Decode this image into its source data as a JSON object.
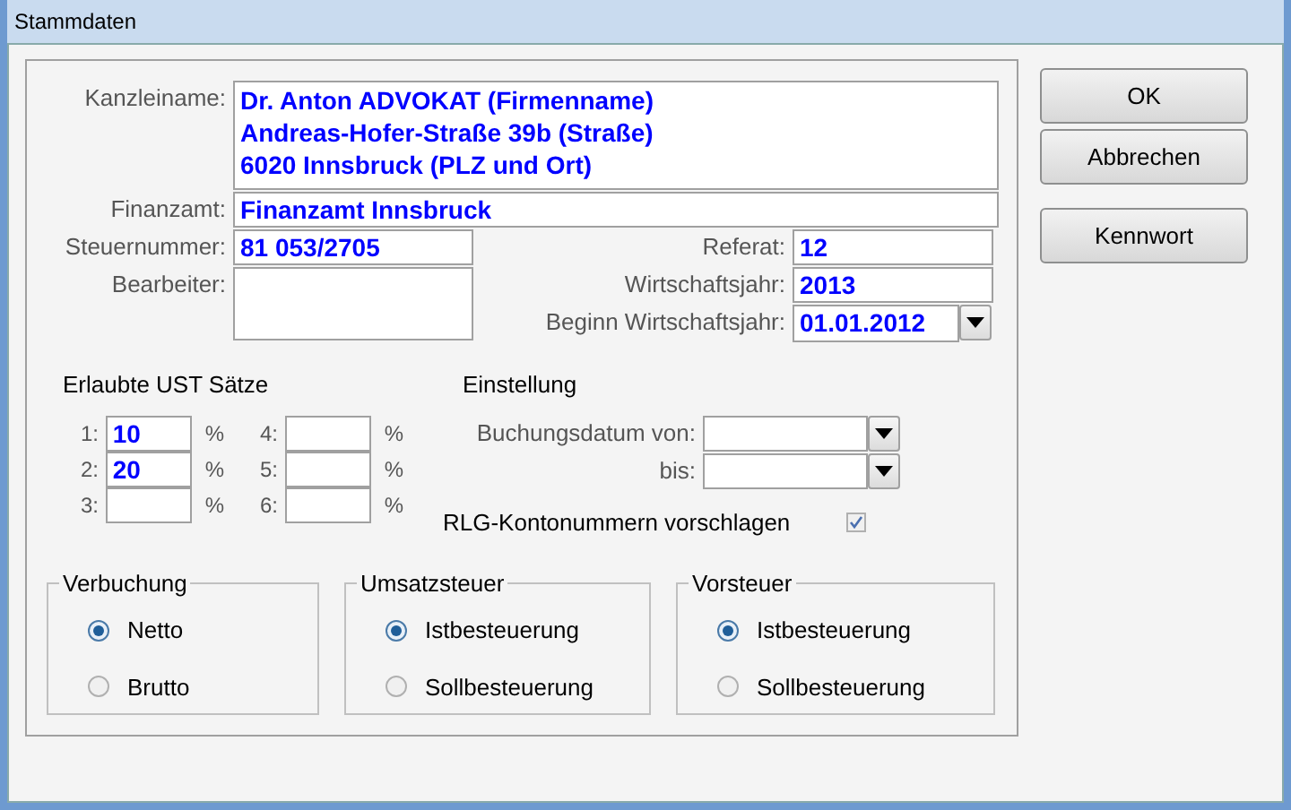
{
  "window": {
    "title": "Stammdaten"
  },
  "fields": [
    {
      "label": "Kanzleiname:",
      "kind": "multiline",
      "lines": [
        "Dr. Anton ADVOKAT (Firmenname)",
        "Andreas-Hofer-Straße 39b (Straße)",
        "6020 Innsbruck (PLZ und Ort)"
      ]
    },
    {
      "label": "Finanzamt:",
      "kind": "wide",
      "value": "Finanzamt Innsbruck"
    }
  ],
  "left_fields": [
    {
      "label": "Steuernummer:",
      "kind": "single",
      "value": "81 053/2705"
    },
    {
      "label": "Bearbeiter:",
      "kind": "multiline"
    }
  ],
  "right_fields": [
    {
      "label": "Referat:",
      "kind": "single",
      "value": "12"
    },
    {
      "label": "Wirtschaftsjahr:",
      "kind": "single",
      "value": "2013"
    },
    {
      "label": "Beginn Wirtschaftsjahr:",
      "kind": "dropdown",
      "value": "01.01.2012"
    }
  ],
  "ust": {
    "title": "Erlaubte UST Sätze",
    "rates": [
      {
        "label": "1:",
        "value": "10",
        "unit": "%"
      },
      {
        "label": "2:",
        "value": "20",
        "unit": "%"
      },
      {
        "label": "3:",
        "unit": "%"
      },
      {
        "label": "4:",
        "unit": "%"
      },
      {
        "label": "5:",
        "unit": "%"
      },
      {
        "label": "6:",
        "unit": "%"
      }
    ]
  },
  "einstellung": {
    "title": "Einstellung",
    "dates": [
      {
        "label": "Buchungsdatum von:"
      },
      {
        "label": "bis:"
      }
    ],
    "checkbox": {
      "label": "RLG-Kontonummern vorschlagen",
      "checked": true
    }
  },
  "groups": [
    {
      "title": "Verbuchung",
      "options": [
        {
          "label": "Netto",
          "selected": true
        },
        {
          "label": "Brutto",
          "selected": false
        }
      ]
    },
    {
      "title": "Umsatzsteuer",
      "options": [
        {
          "label": "Istbesteuerung",
          "selected": true
        },
        {
          "label": "Sollbesteuerung",
          "selected": false
        }
      ]
    },
    {
      "title": "Vorsteuer",
      "options": [
        {
          "label": "Istbesteuerung",
          "selected": true
        },
        {
          "label": "Sollbesteuerung",
          "selected": false
        }
      ]
    }
  ],
  "buttons": [
    "OK",
    "Abbrechen",
    "Kennwort"
  ]
}
